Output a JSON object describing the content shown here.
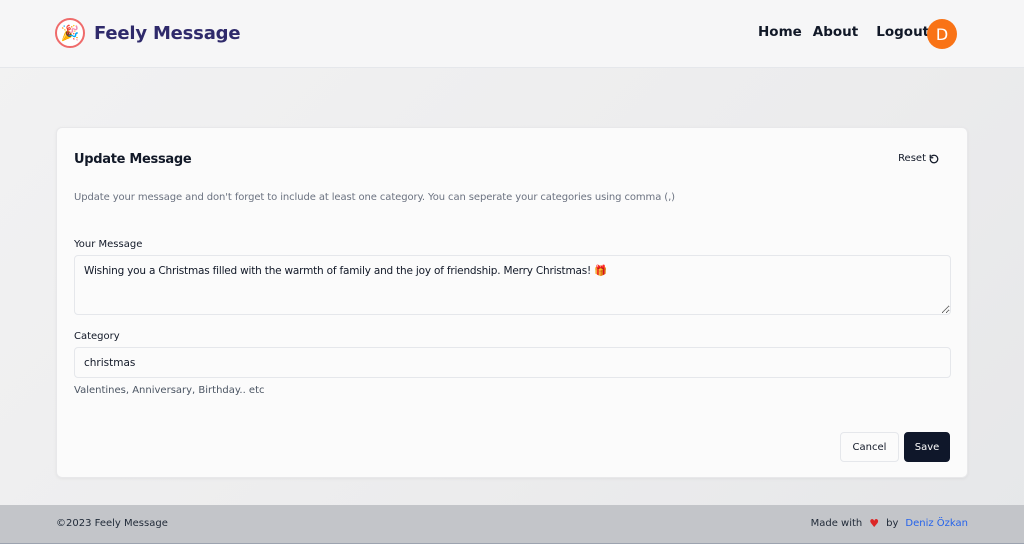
{
  "brand": {
    "name": "Feely Message",
    "logo_icon": "party-popper-icon",
    "logo_glyph": "🎉",
    "color": "#2f2a6b"
  },
  "nav": {
    "home": "Home",
    "about": "About",
    "logout": "Logout",
    "avatar_initial": "D",
    "avatar_color": "#f97316"
  },
  "card": {
    "title": "Update Message",
    "reset_label": "Reset",
    "reset_icon": "rotate-ccw-icon",
    "description": "Update your message and don't forget to include at least one category. You can seperate your categories using comma (,)",
    "message_label": "Your Message",
    "message_value": "Wishing you a Christmas filled with the warmth of family and the joy of friendship. Merry Christmas! 🎁",
    "category_label": "Category",
    "category_value": "christmas",
    "category_hint": "Valentines, Anniversary, Birthday.. etc",
    "cancel_label": "Cancel",
    "save_label": "Save",
    "save_color": "#0f172a"
  },
  "footer": {
    "copyright": "©2023 Feely Message",
    "made_with": "Made with",
    "heart_icon": "heart-icon",
    "by": "by",
    "author": "Deniz Özkan",
    "author_color": "#2563eb"
  }
}
